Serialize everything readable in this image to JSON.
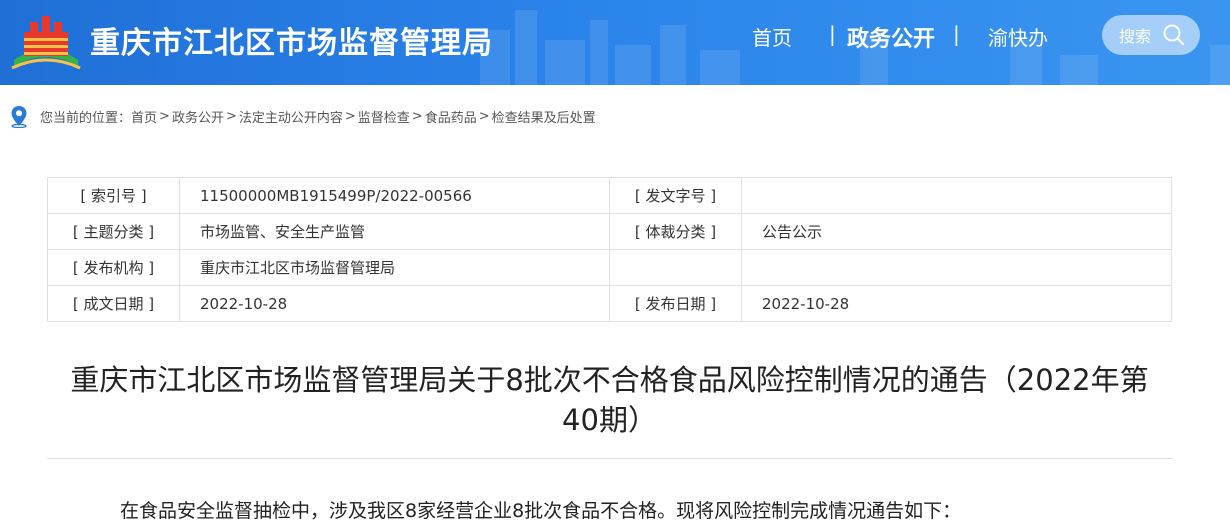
{
  "header": {
    "site_title": "重庆市江北区市场监督管理局",
    "nav": {
      "home": "首页",
      "separator": "|",
      "gov_affairs": "政务公开",
      "service": "渝快办"
    },
    "search_label": "搜索",
    "colors": {
      "bar": "#2a83ea",
      "text": "#ffffff"
    }
  },
  "breadcrumb": {
    "prefix": "您当前的位置：",
    "separator": ">",
    "items": [
      "首页",
      "政务公开",
      "法定主动公开内容",
      "监督检查",
      "食品药品",
      "检查结果及后处置"
    ]
  },
  "info": {
    "index_label": "[ 索引号 ]",
    "index_value": "11500000MB1915499P/2022-00566",
    "doc_no_label": "[ 发文字号 ]",
    "doc_no_value": "",
    "topic_label": "[ 主题分类 ]",
    "topic_value": "市场监管、安全生产监管",
    "genre_label": "[ 体裁分类 ]",
    "genre_value": "公告公示",
    "publisher_label": "[ 发布机构 ]",
    "publisher_value": "重庆市江北区市场监督管理局",
    "created_label": "[ 成文日期 ]",
    "created_value": "2022-10-28",
    "published_label": "[ 发布日期 ]",
    "published_value": "2022-10-28"
  },
  "article": {
    "title_line1": "重庆市江北区市场监督管理局关于8批次不合格食品风险控制情况的通告（2022年第",
    "title_line2": "40期）",
    "intro": "在食品安全监督抽检中，涉及我区8家经营企业8批次食品不合格。现将风险控制完成情况通告如下："
  }
}
